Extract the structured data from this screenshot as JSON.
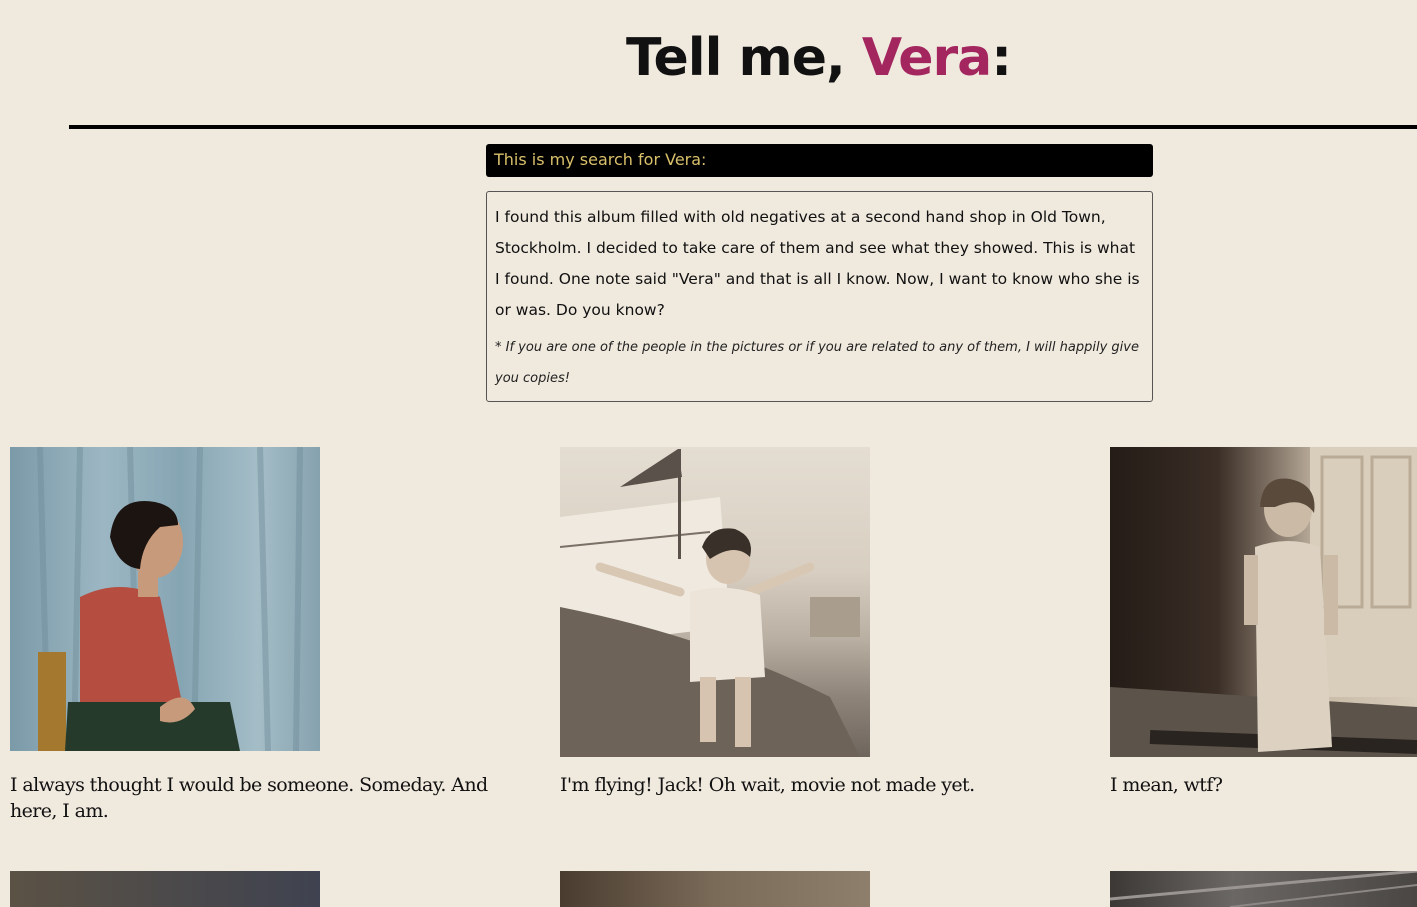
{
  "header": {
    "title_prefix": "Tell me, ",
    "title_name": "Vera",
    "title_suffix": ":"
  },
  "search_bar": {
    "label": "This is my search for Vera:"
  },
  "intro": {
    "text": "I found this album filled with old negatives at a second hand shop in Old Town, Stockholm. I decided to take care of them and see what they showed. This is what I found. One note said \"Vera\" and that is all I know. Now, I want to know who she is or was. Do you know?",
    "note": "* If you are one of the people in the pictures or if you are related to any of them, I will happily give you copies!"
  },
  "gallery": {
    "items": [
      {
        "caption": "I always thought I would be someone. Someday. And here, I am."
      },
      {
        "caption": "I'm flying! Jack! Oh wait, movie not made yet."
      },
      {
        "caption": "I mean, wtf?"
      }
    ]
  },
  "colors": {
    "background": "#f0e9de",
    "accent": "#a3265f",
    "search_text": "#d9c06a"
  }
}
